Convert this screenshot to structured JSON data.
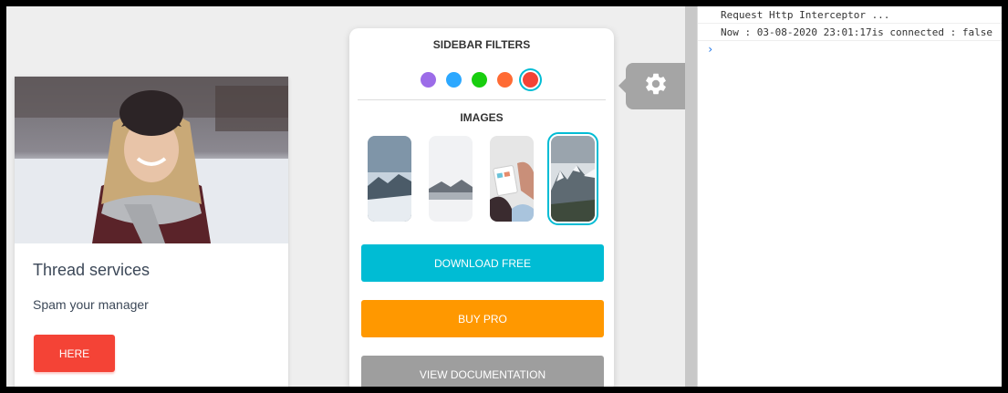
{
  "card": {
    "title": "Thread services",
    "description": "Spam your manager",
    "button_label": "HERE"
  },
  "sidebar": {
    "filters_heading": "SIDEBAR FILTERS",
    "filter_colors": [
      {
        "name": "purple",
        "color": "#9c6ce8"
      },
      {
        "name": "azure",
        "color": "#2ca8ff"
      },
      {
        "name": "green",
        "color": "#18ce0f"
      },
      {
        "name": "orange",
        "color": "#ff6b34"
      },
      {
        "name": "red",
        "color": "#f44336",
        "active": true
      }
    ],
    "images_heading": "IMAGES",
    "images": [
      {
        "name": "mountain-lake-image"
      },
      {
        "name": "misty-lake-image"
      },
      {
        "name": "tablet-hands-image"
      },
      {
        "name": "snowy-peaks-image",
        "active": true
      }
    ],
    "download_label": "DOWNLOAD FREE",
    "buy_label": "BUY PRO",
    "docs_label": "VIEW DOCUMENTATION"
  },
  "colors": {
    "download": "#00bcd4",
    "buy": "#ff9800",
    "docs": "#9e9e9e",
    "card_button": "#f44336"
  },
  "console": {
    "lines": [
      "Request Http Interceptor ...",
      "Now : 03-08-2020 23:01:17is connected : false"
    ],
    "prompt": "›"
  }
}
